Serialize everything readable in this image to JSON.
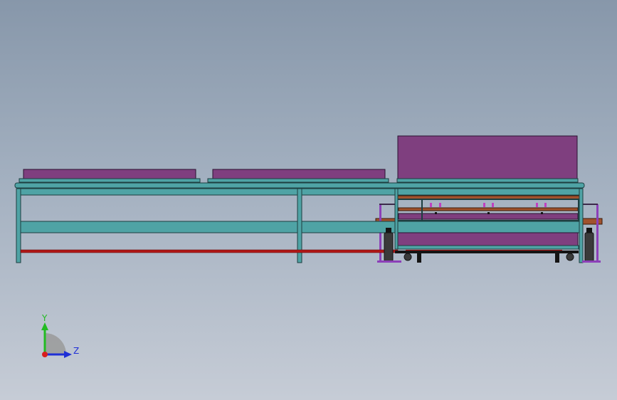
{
  "viewport": {
    "background_top": "#8797aa",
    "background_bottom": "#c6ccd6"
  },
  "model": {
    "colors": {
      "frame": "#4fa3a5",
      "frame_stroke": "#1d3e40",
      "panel": "#7f3f7f",
      "panel_stroke": "#2a1230",
      "wood": "#a0522d",
      "red_rail": "#b01818",
      "black": "#141414",
      "violet_post": "#8c3fb8",
      "cylinder": "#3a3a3a"
    }
  },
  "triad": {
    "y_label": "Y",
    "z_label": "Z",
    "y_color": "#22bb22",
    "z_color": "#1f2fd6",
    "x_color": "#d81e1e"
  }
}
